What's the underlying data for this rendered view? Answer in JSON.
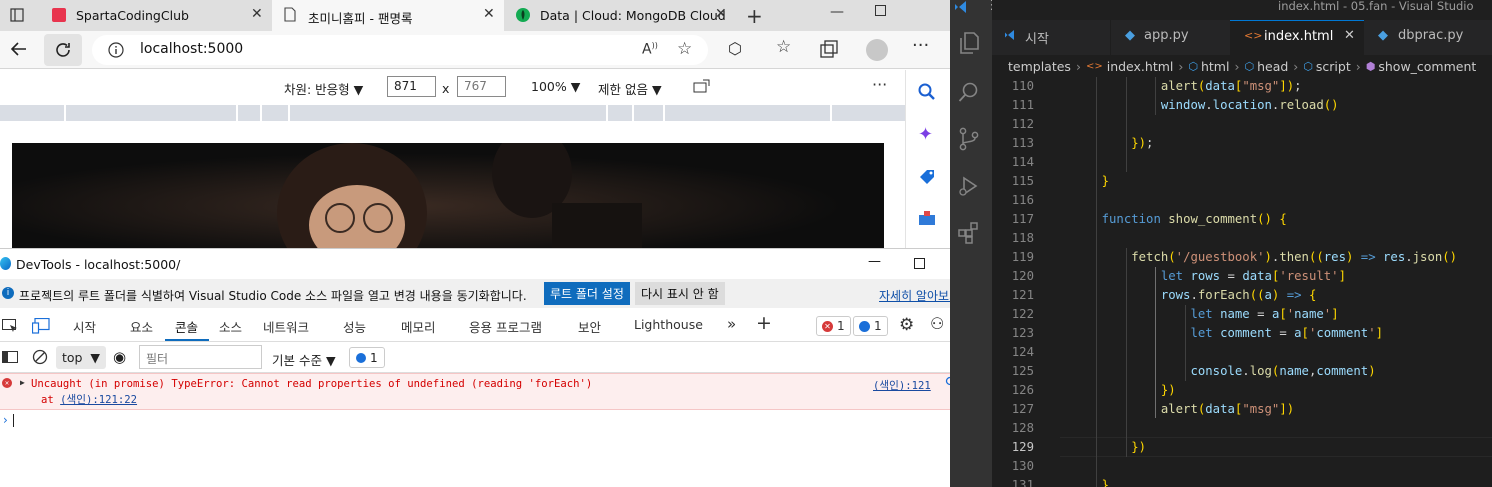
{
  "browser": {
    "tabs": [
      {
        "title": "SpartaCodingClub"
      },
      {
        "title": "초미니홈피 - 팬명록"
      },
      {
        "title": "Data | Cloud: MongoDB Cloud"
      }
    ],
    "url": "localhost:5000",
    "emulation": {
      "dimensions_label": "차원: 반응형",
      "width": "871",
      "height": "767",
      "zoom": "100%",
      "throttle": "제한 없음",
      "x_sign": "x"
    }
  },
  "devtools": {
    "title": "DevTools - localhost:5000/",
    "infobar": {
      "message": "프로젝트의 루트 폴더를 식별하여 Visual Studio Code 소스 파일을 열고 변경 내용을 동기화합니다.",
      "primary_button": "루트 폴더 설정",
      "secondary_button": "다시 표시 안 함",
      "link": "자세히 알아보기"
    },
    "tabs": [
      "시작",
      "요소",
      "콘솔",
      "소스",
      "네트워크",
      "성능",
      "메모리",
      "응용 프로그램",
      "보안",
      "Lighthouse"
    ],
    "active_tab": "콘솔",
    "error_count": "1",
    "info_count": "1",
    "console_toolbar": {
      "context": "top",
      "filter_placeholder": "필터",
      "level": "기본 수준",
      "issues_count": "1"
    },
    "error": {
      "message": "Uncaught (in promise) TypeError: Cannot read properties of undefined (reading 'forEach')",
      "stack": "at ",
      "stack_link": "(색인):121:22",
      "source_link": "(색인):121"
    }
  },
  "vscode": {
    "title": "index.html - 05.fan - Visual Studio",
    "tabs": [
      {
        "label": "시작"
      },
      {
        "label": "app.py"
      },
      {
        "label": "index.html"
      },
      {
        "label": "dbprac.py"
      }
    ],
    "breadcrumb": [
      "templates",
      "index.html",
      "html",
      "head",
      "script",
      "show_comment"
    ],
    "code_lines": [
      {
        "n": "110",
        "text": "            alert(data[\"msg\"]);"
      },
      {
        "n": "111",
        "text": "            window.location.reload()"
      },
      {
        "n": "112",
        "text": ""
      },
      {
        "n": "113",
        "text": "        });"
      },
      {
        "n": "114",
        "text": ""
      },
      {
        "n": "115",
        "text": "    }"
      },
      {
        "n": "116",
        "text": ""
      },
      {
        "n": "117",
        "text": "    function show_comment() {"
      },
      {
        "n": "118",
        "text": ""
      },
      {
        "n": "119",
        "text": "        fetch('/guestbook').then((res) => res.json()"
      },
      {
        "n": "120",
        "text": "            let rows = data['result']"
      },
      {
        "n": "121",
        "text": "            rows.forEach((a) => {"
      },
      {
        "n": "122",
        "text": "                let name = a['name']"
      },
      {
        "n": "123",
        "text": "                let comment = a['comment']"
      },
      {
        "n": "124",
        "text": ""
      },
      {
        "n": "125",
        "text": "                console.log(name,comment)"
      },
      {
        "n": "126",
        "text": "            })"
      },
      {
        "n": "127",
        "text": "            alert(data[\"msg\"])"
      },
      {
        "n": "128",
        "text": ""
      },
      {
        "n": "129",
        "text": "        })"
      },
      {
        "n": "130",
        "text": ""
      },
      {
        "n": "131",
        "text": "    }"
      }
    ]
  }
}
